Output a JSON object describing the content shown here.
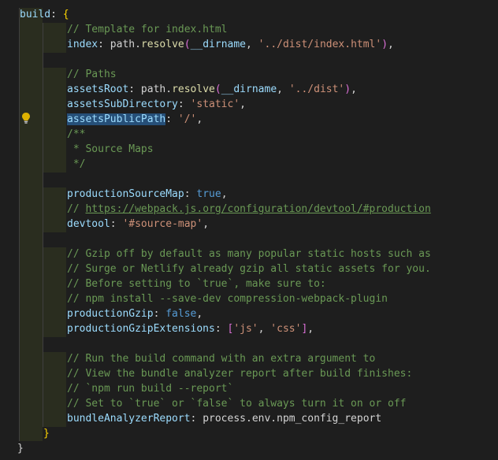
{
  "editor": {
    "lines": [
      [
        {
          "t": "build",
          "c": "k"
        },
        {
          "t": ": ",
          "c": ""
        },
        {
          "t": "{",
          "c": "br"
        }
      ],
      [
        {
          "t": "// Template for index.html",
          "c": "c"
        }
      ],
      [
        {
          "t": "index",
          "c": "k"
        },
        {
          "t": ": path.",
          "c": ""
        },
        {
          "t": "resolve",
          "c": "f"
        },
        {
          "t": "(",
          "c": "bp"
        },
        {
          "t": "__dirname",
          "c": "k"
        },
        {
          "t": ", ",
          "c": ""
        },
        {
          "t": "'../dist/index.html'",
          "c": "s"
        },
        {
          "t": ")",
          "c": "bp"
        },
        {
          "t": ",",
          "c": ""
        }
      ],
      [],
      [
        {
          "t": "// Paths",
          "c": "c"
        }
      ],
      [
        {
          "t": "assetsRoot",
          "c": "k"
        },
        {
          "t": ": path.",
          "c": ""
        },
        {
          "t": "resolve",
          "c": "f"
        },
        {
          "t": "(",
          "c": "bp"
        },
        {
          "t": "__dirname",
          "c": "k"
        },
        {
          "t": ", ",
          "c": ""
        },
        {
          "t": "'../dist'",
          "c": "s"
        },
        {
          "t": ")",
          "c": "bp"
        },
        {
          "t": ",",
          "c": ""
        }
      ],
      [
        {
          "t": "assetsSubDirectory",
          "c": "k"
        },
        {
          "t": ": ",
          "c": ""
        },
        {
          "t": "'static'",
          "c": "s"
        },
        {
          "t": ",",
          "c": ""
        }
      ],
      [
        {
          "t": "assetsPublicPath",
          "c": "k hl"
        },
        {
          "t": ": ",
          "c": ""
        },
        {
          "t": "'/'",
          "c": "s"
        },
        {
          "t": ",",
          "c": ""
        }
      ],
      [
        {
          "t": "/**",
          "c": "c"
        }
      ],
      [
        {
          "t": " * Source Maps",
          "c": "c"
        }
      ],
      [
        {
          "t": " */",
          "c": "c"
        }
      ],
      [],
      [
        {
          "t": "productionSourceMap",
          "c": "k"
        },
        {
          "t": ": ",
          "c": ""
        },
        {
          "t": "true",
          "c": "b"
        },
        {
          "t": ",",
          "c": ""
        }
      ],
      [
        {
          "t": "// ",
          "c": "c"
        },
        {
          "t": "https://webpack.js.org/configuration/devtool/#production",
          "c": "c u"
        }
      ],
      [
        {
          "t": "devtool",
          "c": "k"
        },
        {
          "t": ": ",
          "c": ""
        },
        {
          "t": "'#source-map'",
          "c": "s"
        },
        {
          "t": ",",
          "c": ""
        }
      ],
      [],
      [
        {
          "t": "// Gzip off by default as many popular static hosts such as",
          "c": "c"
        }
      ],
      [
        {
          "t": "// Surge or Netlify already gzip all static assets for you.",
          "c": "c"
        }
      ],
      [
        {
          "t": "// Before setting to `true`, make sure to:",
          "c": "c"
        }
      ],
      [
        {
          "t": "// npm install --save-dev compression-webpack-plugin",
          "c": "c"
        }
      ],
      [
        {
          "t": "productionGzip",
          "c": "k"
        },
        {
          "t": ": ",
          "c": ""
        },
        {
          "t": "false",
          "c": "b"
        },
        {
          "t": ",",
          "c": ""
        }
      ],
      [
        {
          "t": "productionGzipExtensions",
          "c": "k"
        },
        {
          "t": ": ",
          "c": ""
        },
        {
          "t": "[",
          "c": "bp"
        },
        {
          "t": "'js'",
          "c": "s"
        },
        {
          "t": ", ",
          "c": ""
        },
        {
          "t": "'css'",
          "c": "s"
        },
        {
          "t": "]",
          "c": "bp"
        },
        {
          "t": ",",
          "c": ""
        }
      ],
      [],
      [
        {
          "t": "// Run the build command with an extra argument to",
          "c": "c"
        }
      ],
      [
        {
          "t": "// View the bundle analyzer report after build finishes:",
          "c": "c"
        }
      ],
      [
        {
          "t": "// `npm run build --report`",
          "c": "c"
        }
      ],
      [
        {
          "t": "// Set to `true` or `false` to always turn it on or off",
          "c": "c"
        }
      ],
      [
        {
          "t": "bundleAnalyzerReport",
          "c": "k"
        },
        {
          "t": ": process.env.npm_config_report",
          "c": ""
        }
      ],
      [
        {
          "t": "}",
          "c": "br"
        }
      ],
      [
        {
          "t": "}",
          "c": ""
        }
      ]
    ]
  }
}
